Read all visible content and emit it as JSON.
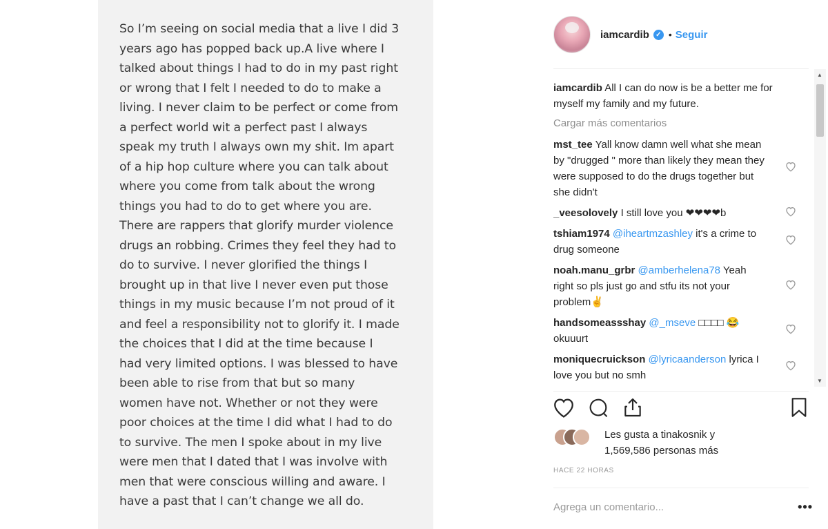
{
  "note": {
    "text": "So I’m seeing on social media that a live I did 3\nyears ago has popped back up.A live where I\ntalked about things I had to do in my past right\nor wrong that I felt I needed to do to make a\nliving. I never claim to be perfect or come from\na perfect world wit a perfect past I always\nspeak my truth I always own my shit. Im apart\nof a hip hop culture where you can talk about\nwhere you come from talk about the wrong\nthings you had to do to get where you are.\nThere are rappers that glorify murder violence\ndrugs an robbing. Crimes they feel they had to\ndo to survive. I never glorified the things I\nbrought up in that live I never even put those\nthings in my music because I’m not proud of it\nand feel a responsibility not to glorify it. I made\nthe choices that I did at the time because I\nhad very limited options. I was blessed to have\nbeen able to rise from that but so many\nwomen have not. Whether or not they were\npoor choices at the time I did what I had to do\nto survive. The men I spoke about in my live\nwere men that I dated that I was involve with\nmen that were conscious willing and aware. I\nhave a past that I can’t change we all do."
  },
  "post": {
    "username": "iamcardib",
    "verified_glyph": "✓",
    "dot": "•",
    "follow_label": "Seguir",
    "caption_user": "iamcardib",
    "caption_text": "All I can do now is be a better me for myself my family and my future.",
    "load_more": "Cargar más comentarios",
    "comments": [
      {
        "user": "mst_tee",
        "mention": "",
        "text": "Yall know damn well what she mean by \"drugged \" more than likely they mean they were supposed to do the drugs together but she didn't"
      },
      {
        "user": "_veesolovely",
        "mention": "",
        "text": "I still love you ❤❤❤❤b"
      },
      {
        "user": "tshiam1974",
        "mention": "@iheartmzashley",
        "text": "it's a crime to drug someone"
      },
      {
        "user": "noah.manu_grbr",
        "mention": "@amberhelena78",
        "text": "Yeah right so pls just go and stfu its not your problem✌"
      },
      {
        "user": "handsomeassshay",
        "mention": "@_mseve",
        "text": "□□□□ 😂 okuuurt"
      },
      {
        "user": "moniquecruickson",
        "mention": "@lyricaanderson",
        "text": "lyrica I love you but no smh"
      }
    ],
    "likes_line1": "Les gusta a tinakosnik y",
    "likes_line2": "1,569,586 personas más",
    "time_ago": "HACE 22 HORAS",
    "comment_placeholder": "Agrega un comentario...",
    "more_label": "•••",
    "scroll_up": "▲",
    "scroll_down": "▼"
  }
}
